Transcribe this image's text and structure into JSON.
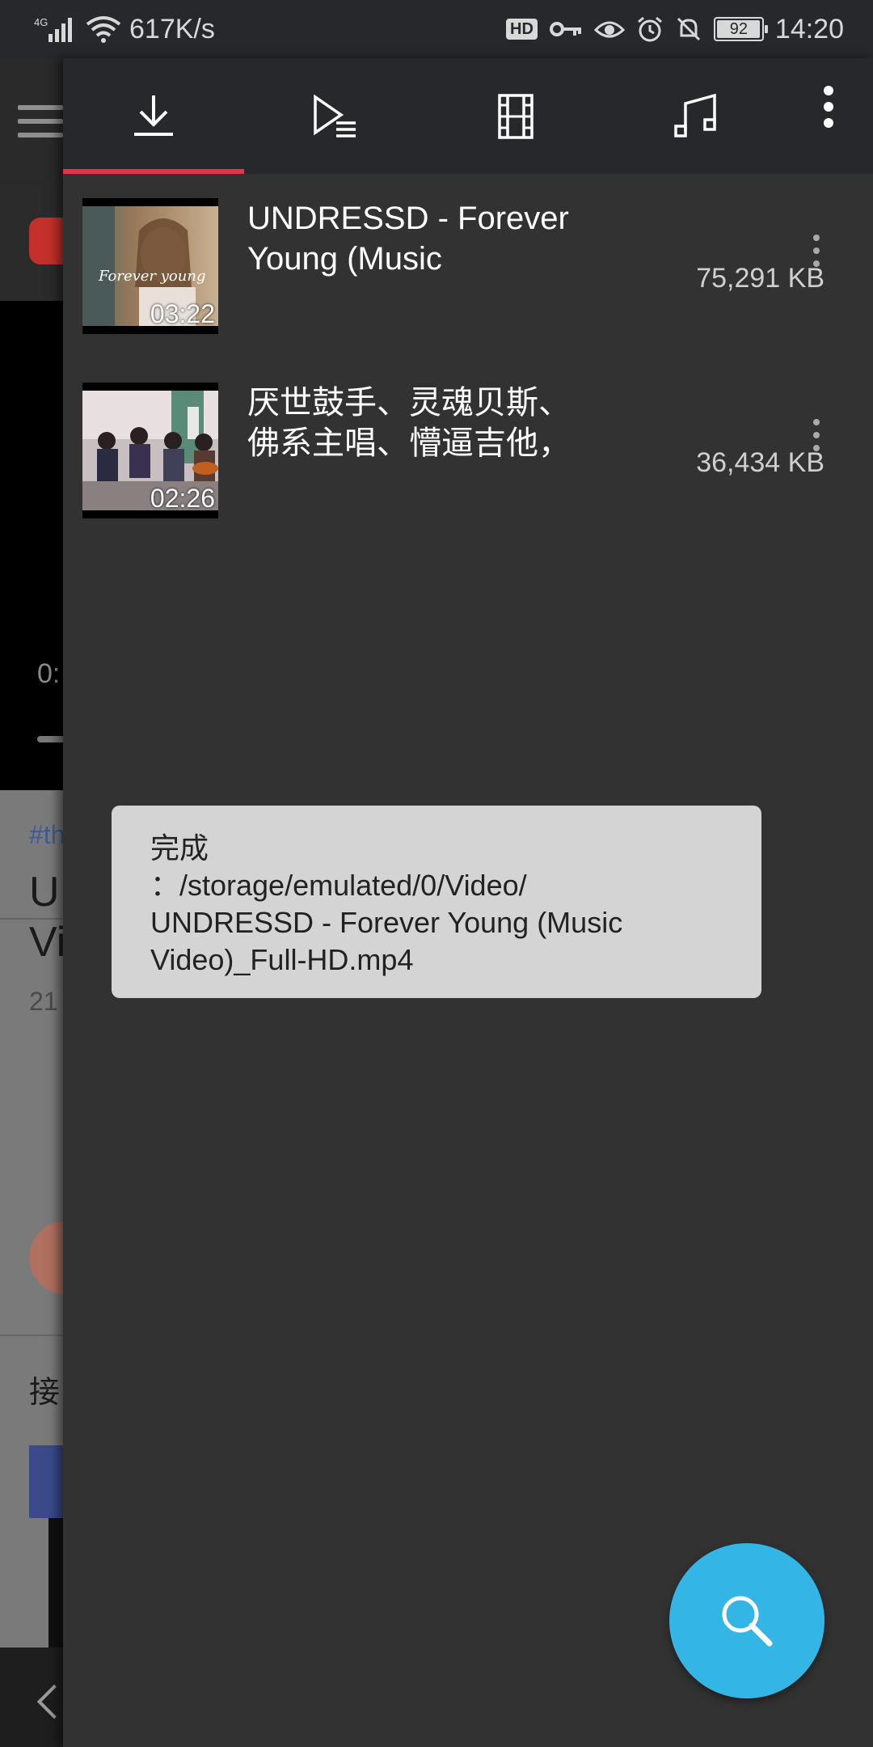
{
  "status_bar": {
    "network": "4G",
    "speed": "617K/s",
    "hd": "HD",
    "battery": "92",
    "time": "14:20"
  },
  "background_app": {
    "time_fragment": "0:",
    "tag_fragment": "#th",
    "title_fragment": "U\nVi",
    "subtitle_fragment": "21",
    "next_fragment": "接"
  },
  "tabs": [
    {
      "name": "downloads",
      "icon": "download-icon",
      "selected": true
    },
    {
      "name": "playlist",
      "icon": "playlist-icon",
      "selected": false
    },
    {
      "name": "video",
      "icon": "film-icon",
      "selected": false
    },
    {
      "name": "music",
      "icon": "music-note-icon",
      "selected": false
    }
  ],
  "downloads": [
    {
      "title": "UNDRESSD - Forever Young (Music",
      "duration": "03:22",
      "size": "75,291 KB",
      "thumb_text": "Forever young"
    },
    {
      "title": "厌世鼓手、灵魂贝斯、佛系主唱、懵逼吉他，",
      "duration": "02:26",
      "size": "36,434 KB"
    }
  ],
  "toast": {
    "message": "完成\n：/storage/emulated/0/Video/\nUNDRESSD - Forever Young (Music\nVideo)_Full-HD.mp4"
  },
  "colors": {
    "accent": "#e8334a",
    "fab": "#33b5e5",
    "panel": "#323232",
    "tabbar": "#26282c"
  }
}
